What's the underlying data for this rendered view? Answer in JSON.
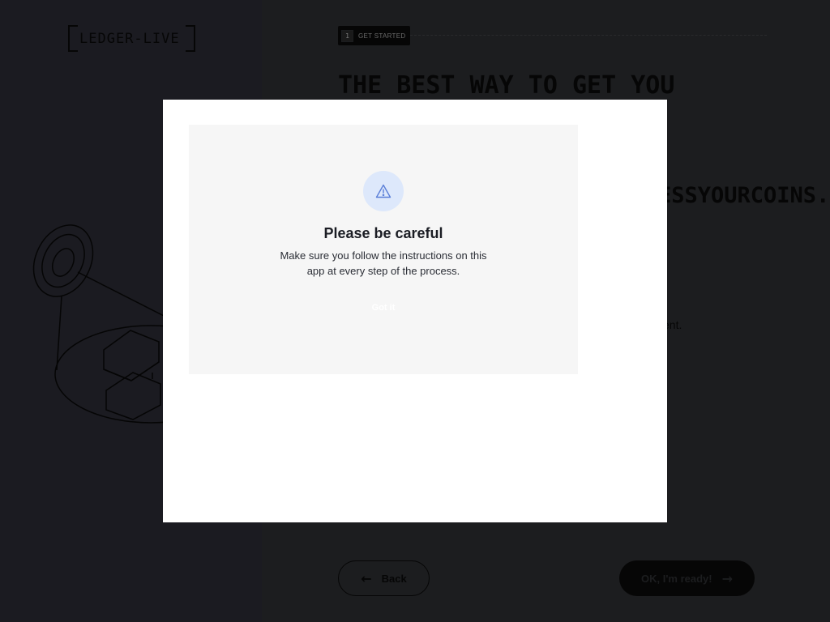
{
  "app": {
    "logo_text": "LEDGER-LIVE"
  },
  "onboarding": {
    "step_number": "1",
    "step_label": "GET STARTED",
    "title": "THE BEST WAY TO GET YOU",
    "subtitle_fragment": "ESSYOURCOINS.",
    "body_fragment": "ent.",
    "back_label": "Back",
    "ok_label": "OK, I'm ready!"
  },
  "modal": {
    "icon": "warning-triangle-icon",
    "title": "Please be careful",
    "message": "Make sure you follow the instructions on this app at every step of the process.",
    "got_it_label": "Got it"
  },
  "colors": {
    "modal_accent": "#dde8fb",
    "icon_stroke": "#5b7fd8",
    "dark_panel": "#1b1b21"
  }
}
